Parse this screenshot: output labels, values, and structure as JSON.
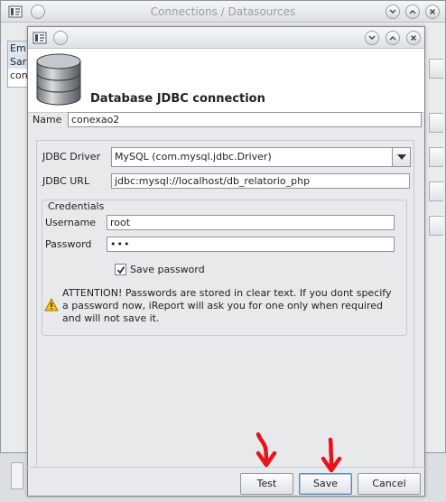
{
  "background_window": {
    "title": "Connections / Datasources",
    "list_items": [
      "Em",
      "Sar",
      "con"
    ]
  },
  "dialog": {
    "heading": "Database JDBC connection",
    "name_label": "Name",
    "name_value": "conexao2",
    "driver_label": "JDBC Driver",
    "driver_value": "MySQL (com.mysql.jdbc.Driver)",
    "url_label": "JDBC URL",
    "url_value": "jdbc:mysql://localhost/db_relatorio_php",
    "credentials_legend": "Credentials",
    "username_label": "Username",
    "username_value": "root",
    "password_label": "Password",
    "password_value": "•••",
    "save_password_label": "Save password",
    "save_password_checked": true,
    "warning_text": "ATTENTION! Passwords are stored in clear text. If you dont specify a password now, iReport will ask you for one only when required and will not save it."
  },
  "buttons": {
    "test": "Test",
    "save": "Save",
    "cancel": "Cancel"
  },
  "icons": {
    "window_controls": [
      "chevron-down-icon",
      "chevron-up-icon",
      "close-icon"
    ],
    "annotation_arrow_color": "#e8131a"
  }
}
